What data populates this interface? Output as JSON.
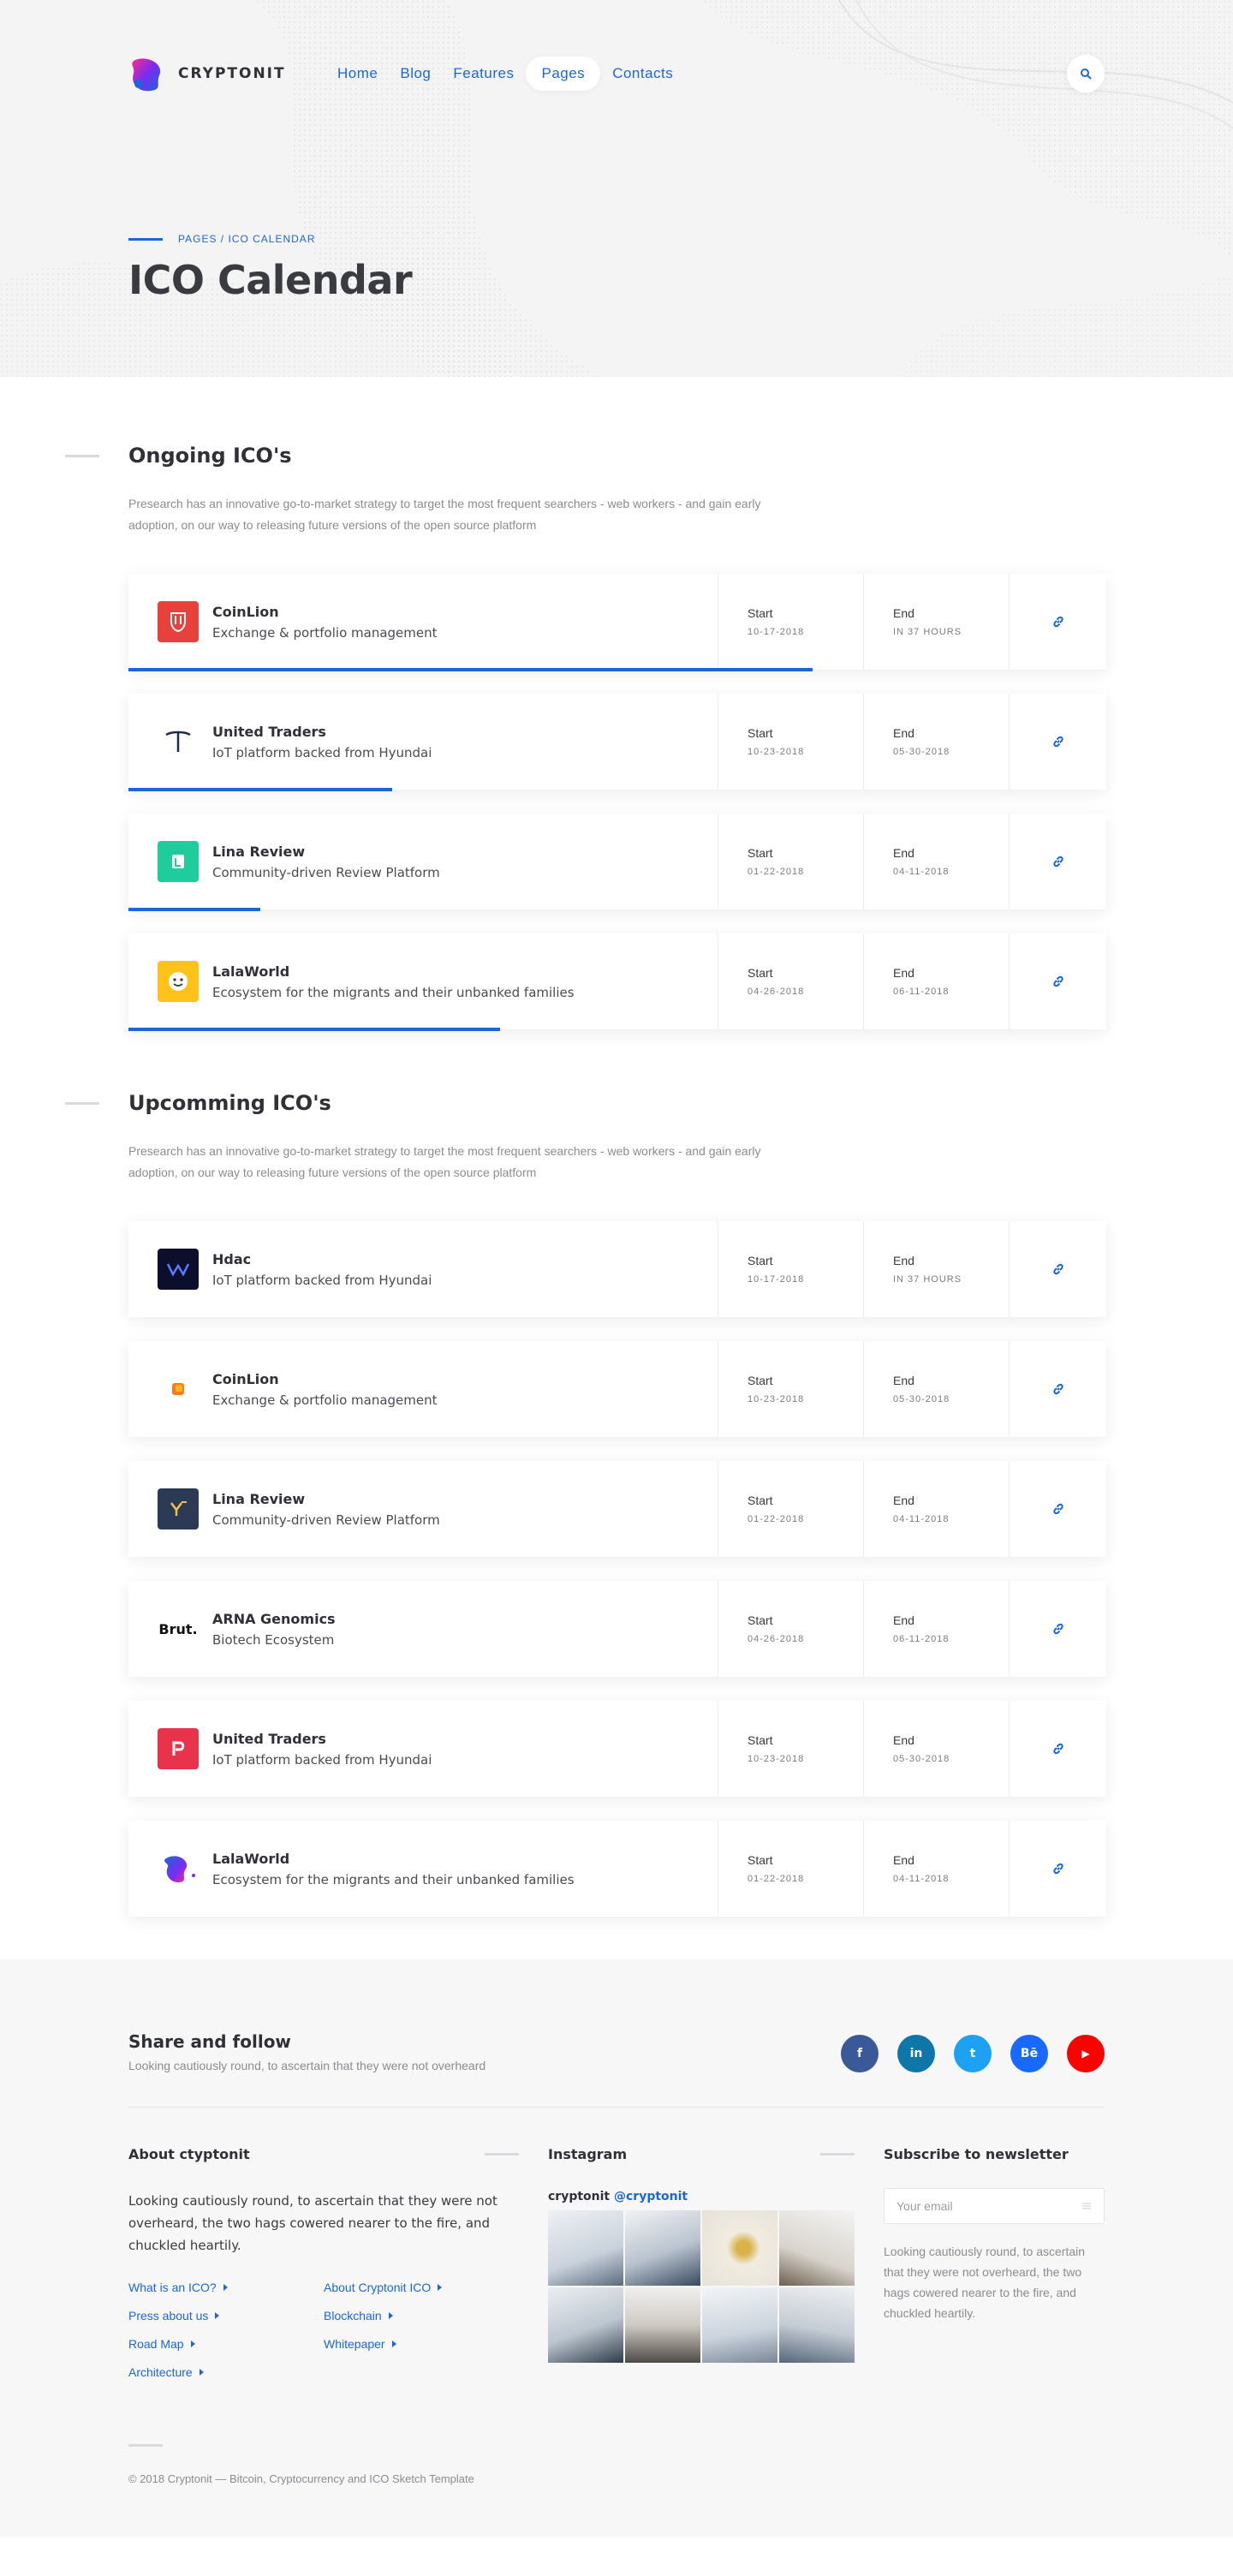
{
  "brand": {
    "name": "CRYPTONIT"
  },
  "nav": {
    "items": [
      {
        "label": "Home"
      },
      {
        "label": "Blog"
      },
      {
        "label": "Features"
      },
      {
        "label": "Pages"
      },
      {
        "label": "Contacts"
      }
    ],
    "active": "Pages",
    "search_icon": "search-icon"
  },
  "hero": {
    "breadcrumb": "PAGES / ICO CALENDAR",
    "title": "ICO Calendar"
  },
  "ongoing": {
    "title": "Ongoing ICO's",
    "description": "Presearch has an innovative go-to-market strategy to target the most frequent searchers - web workers - and gain early adoption, on our way to releasing future versions of the open source platform",
    "rows": [
      {
        "name": "CoinLion",
        "desc": "Exchange & portfolio management",
        "start_label": "Start",
        "start": "10-17-2018",
        "end_label": "End",
        "end": "IN 37 HOURS",
        "progress": 0.7,
        "logo_color": "#e8413b",
        "icon": "shield-logo-icon"
      },
      {
        "name": "United Traders",
        "desc": "IoT platform backed from Hyundai",
        "start_label": "Start",
        "start": "10-23-2018",
        "end_label": "End",
        "end": "05-30-2018",
        "progress": 0.27,
        "logo_color": "#ffffff",
        "icon": "anchor-logo-icon"
      },
      {
        "name": "Lina Review",
        "desc": "Community-driven Review Platform",
        "start_label": "Start",
        "start": "01-22-2018",
        "end_label": "End",
        "end": "04-11-2018",
        "progress": 0.135,
        "logo_color": "#1fcc9c",
        "icon": "lina-logo-icon"
      },
      {
        "name": "LalaWorld",
        "desc": "Ecosystem for the migrants and their unbanked families",
        "start_label": "Start",
        "start": "04-26-2018",
        "end_label": "End",
        "end": "06-11-2018",
        "progress": 0.38,
        "logo_color": "#ffc21a",
        "icon": "smiley-logo-icon"
      }
    ]
  },
  "upcoming": {
    "title": "Upcomming ICO's",
    "description": "Presearch has an innovative go-to-market strategy to target the most frequent searchers - web workers - and gain early adoption, on our way to releasing future versions of the open source platform",
    "rows": [
      {
        "name": "Hdac",
        "desc": "IoT platform backed from Hyundai",
        "start_label": "Start",
        "start": "10-17-2018",
        "end_label": "End",
        "end": "IN 37 HOURS",
        "logo_color": "#0c0f2c",
        "icon": "hdac-logo-icon"
      },
      {
        "name": "CoinLion",
        "desc": "Exchange & portfolio management",
        "start_label": "Start",
        "start": "10-23-2018",
        "end_label": "End",
        "end": "05-30-2018",
        "logo_color": "#ffffff",
        "icon": "orange-cube-logo-icon"
      },
      {
        "name": "Lina Review",
        "desc": "Community-driven Review Platform",
        "start_label": "Start",
        "start": "01-22-2018",
        "end_label": "End",
        "end": "04-11-2018",
        "logo_color": "#2d3a56",
        "icon": "yx-logo-icon"
      },
      {
        "name": "ARNA Genomics",
        "desc": "Biotech Ecosystem",
        "start_label": "Start",
        "start": "04-26-2018",
        "end_label": "End",
        "end": "06-11-2018",
        "logo_color": "#ffffff",
        "icon": "brut-logo-icon",
        "logo_text": "Brut."
      },
      {
        "name": "United Traders",
        "desc": "IoT platform backed from Hyundai",
        "start_label": "Start",
        "start": "10-23-2018",
        "end_label": "End",
        "end": "05-30-2018",
        "logo_color": "#e8334a",
        "icon": "p-logo-icon"
      },
      {
        "name": "LalaWorld",
        "desc": "Ecosystem for the migrants and their unbanked families",
        "start_label": "Start",
        "start": "01-22-2018",
        "end_label": "End",
        "end": "04-11-2018",
        "logo_color": "#ffffff",
        "icon": "blob-logo-icon"
      }
    ]
  },
  "footer": {
    "share_title": "Share and follow",
    "share_sub": "Looking cautiously round, to ascertain that they were not overheard",
    "socials": [
      {
        "name": "facebook",
        "glyph": "f",
        "color": "#3b5998"
      },
      {
        "name": "linkedin",
        "glyph": "in",
        "color": "#0e76a8"
      },
      {
        "name": "twitter",
        "glyph": "t",
        "color": "#1da1f2"
      },
      {
        "name": "behance",
        "glyph": "Bē",
        "color": "#1769ff"
      },
      {
        "name": "youtube",
        "glyph": "▶",
        "color": "#ff0000"
      }
    ],
    "about_title": "About ctyptonit",
    "about_text": "Looking cautiously round, to ascertain that they were not overheard, the two hags cowered nearer to the fire, and chuckled heartily.",
    "links": [
      "What is an ICO?",
      "About Cryptonit ICO",
      "Press about us",
      "Blockchain",
      "Road Map",
      "Whitepaper",
      "Architecture"
    ],
    "instagram_title": "Instagram",
    "instagram_name": "cryptonit",
    "instagram_handle": "@cryptonit",
    "newsletter_title": "Subscribe to newsletter",
    "email_placeholder": "Your email",
    "newsletter_text": "Looking cautiously round, to ascertain that they were not overheard, the two hags cowered nearer to the fire, and chuckled heartily.",
    "copyright": "© 2018 Cryptonit — Bitcoin, Cryptocurrency and ICO Sketch Template"
  }
}
